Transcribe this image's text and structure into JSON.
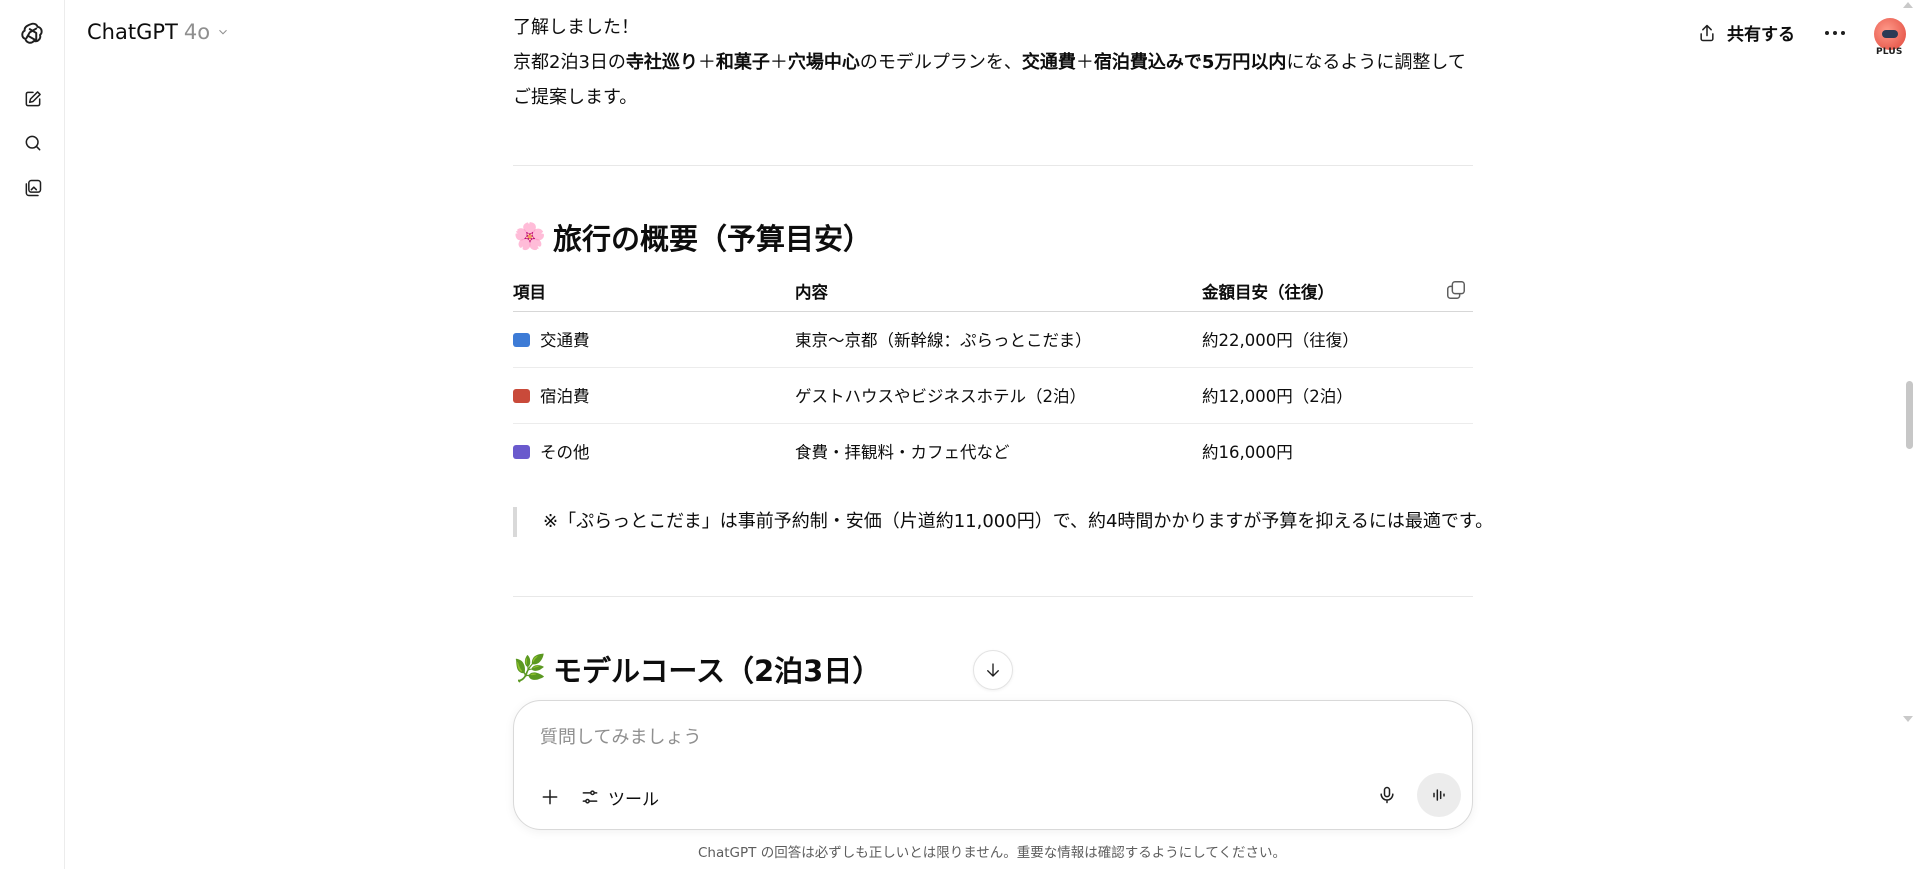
{
  "header": {
    "model_name": "ChatGPT",
    "model_version": "4o",
    "share_label": "共有する",
    "plan_badge": "PLUS"
  },
  "intro": {
    "line1": "了解しました！",
    "line2_parts": [
      {
        "text": "京都2泊3日の",
        "bold": false
      },
      {
        "text": "寺社巡り",
        "bold": true
      },
      {
        "text": "＋",
        "bold": false
      },
      {
        "text": "和菓子",
        "bold": true
      },
      {
        "text": "＋",
        "bold": false
      },
      {
        "text": "穴場中心",
        "bold": true
      },
      {
        "text": "のモデルプランを、",
        "bold": false
      },
      {
        "text": "交通費",
        "bold": true
      },
      {
        "text": "＋",
        "bold": false
      },
      {
        "text": "宿泊費込みで5万円以内",
        "bold": true
      },
      {
        "text": "になるように調整して",
        "bold": false
      }
    ],
    "line3": "ご提案します。"
  },
  "section1": {
    "emoji": "🌸",
    "title": "旅行の概要（予算目安）",
    "table": {
      "headers": [
        "項目",
        "内容",
        "金額目安（往復）"
      ],
      "rows": [
        {
          "icon_color": "#3d7bd6",
          "item": "交通費",
          "detail": "東京〜京都（新幹線：ぷらっとこだま）",
          "amount": "約22,000円（往復）"
        },
        {
          "icon_color": "#c94a3a",
          "item": "宿泊費",
          "detail": "ゲストハウスやビジネスホテル（2泊）",
          "amount": "約12,000円（2泊）"
        },
        {
          "icon_color": "#6a5acd",
          "item": "その他",
          "detail": "食費・拝観料・カフェ代など",
          "amount": "約16,000円"
        }
      ]
    },
    "note": "※「ぷらっとこだま」は事前予約制・安価（片道約11,000円）で、約4時間かかりますが予算を抑えるには最適です。"
  },
  "section2": {
    "emoji": "🌿",
    "title": "モデルコース（2泊3日）"
  },
  "composer": {
    "placeholder": "質問してみましょう",
    "tools_label": "ツール"
  },
  "footer": {
    "disclaimer": "ChatGPT の回答は必ずしも正しいとは限りません。重要な情報は確認するようにしてください。"
  }
}
